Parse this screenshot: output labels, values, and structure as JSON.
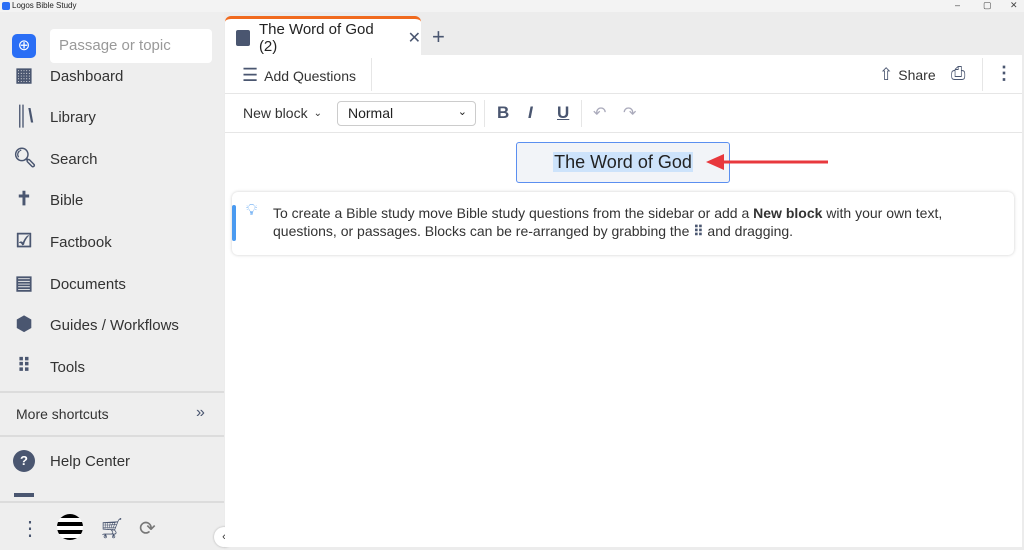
{
  "window": {
    "title": "Logos Bible Study",
    "controls": [
      "–",
      "▢",
      "✕"
    ]
  },
  "sidebar": {
    "search_placeholder": "Passage or topic",
    "items": [
      {
        "label": "Dashboard",
        "icon": "dashboard-icon"
      },
      {
        "label": "Library",
        "icon": "library-icon"
      },
      {
        "label": "Search",
        "icon": "search-icon"
      },
      {
        "label": "Bible",
        "icon": "bible-icon"
      },
      {
        "label": "Factbook",
        "icon": "factbook-icon"
      },
      {
        "label": "Documents",
        "icon": "documents-icon"
      },
      {
        "label": "Guides / Workflows",
        "icon": "guides-icon"
      },
      {
        "label": "Tools",
        "icon": "tools-icon"
      }
    ],
    "more_shortcuts": "More shortcuts",
    "help_center": "Help Center"
  },
  "tab": {
    "label": "The Word of God (2)"
  },
  "toolbar": {
    "add_questions": "Add Questions",
    "share": "Share"
  },
  "format_bar": {
    "new_block": "New block",
    "style": "Normal",
    "bold": "B",
    "italic": "I",
    "underline": "U"
  },
  "document": {
    "title": "The Word of God",
    "hint_part1": "To create a Bible study move Bible study questions from the sidebar or add a ",
    "hint_bold": "New block",
    "hint_part2": " with your own text, questions, or passages. Blocks can be re-arranged by grabbing the ",
    "hint_part3": " and dragging."
  },
  "colors": {
    "accent": "#2a6ef5",
    "tab_indicator": "#f06a1e",
    "annotation_arrow": "#e8383d",
    "selection": "#cde3fb"
  }
}
